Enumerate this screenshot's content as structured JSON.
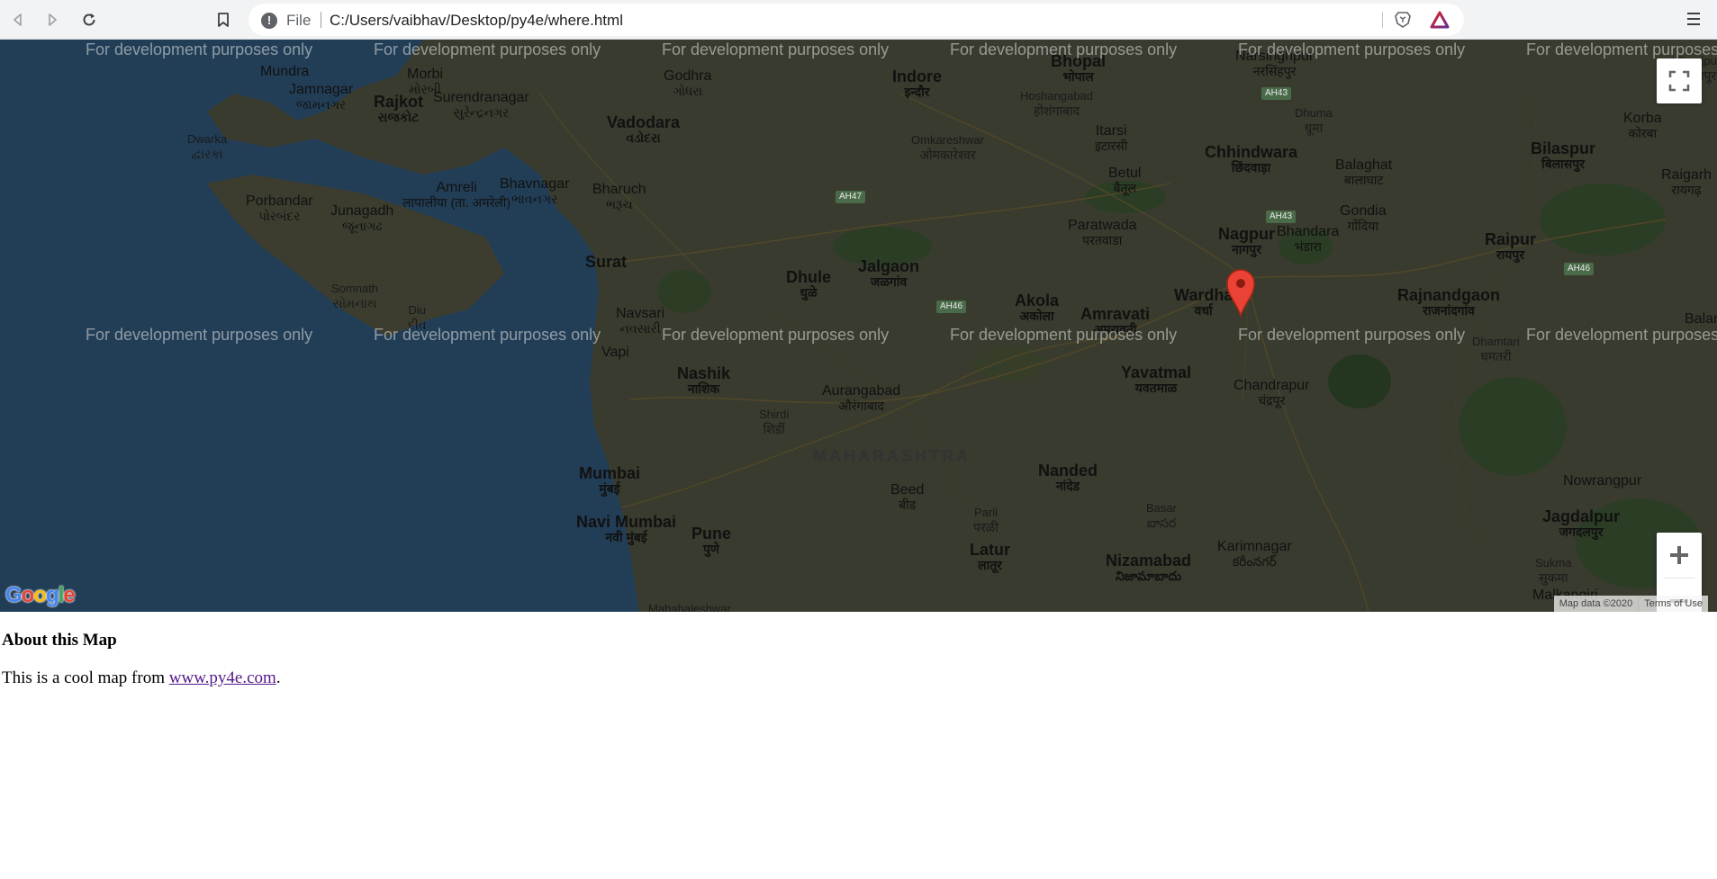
{
  "browser": {
    "scheme_label": "File",
    "url": "C:/Users/vaibhav/Desktop/py4e/where.html"
  },
  "map": {
    "watermark": "For development purposes only",
    "state_label": "MAHARASHTRA",
    "cities": [
      {
        "name": "Mundra",
        "native": ""
      },
      {
        "name": "Jamnagar",
        "native": "જામનગર"
      },
      {
        "name": "Morbi",
        "native": "મોરબી"
      },
      {
        "name": "Rajkot",
        "native": "રાજકોટ"
      },
      {
        "name": "Surendranagar",
        "native": "સુરેન્દ્રનગર"
      },
      {
        "name": "Dwarka",
        "native": "દ્વારકા"
      },
      {
        "name": "Porbandar",
        "native": "પોરબંદર"
      },
      {
        "name": "Junagadh",
        "native": "જૂનાગઢ"
      },
      {
        "name": "Amreli",
        "native": "लापालीया (ता. अमरेली)"
      },
      {
        "name": "Bhavnagar",
        "native": "ભાવનગર"
      },
      {
        "name": "Somnath",
        "native": "સોમનાથ"
      },
      {
        "name": "Diu",
        "native": "દીવ"
      },
      {
        "name": "Godhra",
        "native": "ગોધરા"
      },
      {
        "name": "Vadodara",
        "native": "વડોદરા"
      },
      {
        "name": "Bharuch",
        "native": "ભરૂચ"
      },
      {
        "name": "Surat",
        "native": ""
      },
      {
        "name": "Navsari",
        "native": "નવસારી"
      },
      {
        "name": "Vapi",
        "native": ""
      },
      {
        "name": "Indore",
        "native": "इन्दौर"
      },
      {
        "name": "Bhopal",
        "native": "भोपाल"
      },
      {
        "name": "Hoshangabad",
        "native": "होशंगाबाद"
      },
      {
        "name": "Omkareshwar",
        "native": "ओमकारेश्वर"
      },
      {
        "name": "Itarsi",
        "native": "इटारसी"
      },
      {
        "name": "Betul",
        "native": "बैतूल"
      },
      {
        "name": "Narsinghpur",
        "native": "नरसिंहपुर"
      },
      {
        "name": "Chhindwara",
        "native": "छिंदवाड़ा"
      },
      {
        "name": "Dhuma",
        "native": "धूमा"
      },
      {
        "name": "Balaghat",
        "native": "बालाघाट"
      },
      {
        "name": "Gondia",
        "native": "गोंदिया"
      },
      {
        "name": "Bhandara",
        "native": "भंडारा"
      },
      {
        "name": "Nagpur",
        "native": "नागपुर"
      },
      {
        "name": "Paratwada",
        "native": "परतवाडा"
      },
      {
        "name": "Jalgaon",
        "native": "जळगांव"
      },
      {
        "name": "Dhule",
        "native": "धुळे"
      },
      {
        "name": "Akola",
        "native": "अकोला"
      },
      {
        "name": "Amravati",
        "native": "अमरावती"
      },
      {
        "name": "Wardha",
        "native": "वर्धा"
      },
      {
        "name": "Yavatmal",
        "native": "यवतमाळ"
      },
      {
        "name": "Chandrapur",
        "native": "चंद्रपूर"
      },
      {
        "name": "Nashik",
        "native": "नाशिक"
      },
      {
        "name": "Shirdi",
        "native": "शिर्डी"
      },
      {
        "name": "Aurangabad",
        "native": "औरंगाबाद"
      },
      {
        "name": "Mumbai",
        "native": "मुंबई"
      },
      {
        "name": "Navi Mumbai",
        "native": "नवी मुंबई"
      },
      {
        "name": "Pune",
        "native": "पुणे"
      },
      {
        "name": "Mahabaleshwar",
        "native": ""
      },
      {
        "name": "Beed",
        "native": "बीड"
      },
      {
        "name": "Parli",
        "native": "परळी"
      },
      {
        "name": "Nanded",
        "native": "नांदेड"
      },
      {
        "name": "Latur",
        "native": "लातूर"
      },
      {
        "name": "Basar",
        "native": "బాసర"
      },
      {
        "name": "Nizamabad",
        "native": "నిజామాబాదు"
      },
      {
        "name": "Karimnagar",
        "native": "కరీంనగర్"
      },
      {
        "name": "Surajpur",
        "native": "सूरजपुर"
      },
      {
        "name": "Korba",
        "native": "कोरबा"
      },
      {
        "name": "Bilaspur",
        "native": "बिलासपुर"
      },
      {
        "name": "Raigarh",
        "native": "रायगढ़"
      },
      {
        "name": "Raipur",
        "native": "रायपुर"
      },
      {
        "name": "Rajnandgaon",
        "native": "राजनांदगांव"
      },
      {
        "name": "Dhamtari",
        "native": "धमतरी"
      },
      {
        "name": "Balang",
        "native": ""
      },
      {
        "name": "Nowrangpur",
        "native": ""
      },
      {
        "name": "Jagdalpur",
        "native": "जगदलपुर"
      },
      {
        "name": "Sukma",
        "native": "सुकमा"
      },
      {
        "name": "Malkangiri",
        "native": ""
      }
    ],
    "highways": [
      "AH47",
      "AH46",
      "AH43",
      "AH43",
      "AH46"
    ],
    "attribution": "Map data ©2020",
    "terms": "Terms of Use",
    "logo_letters": [
      "G",
      "o",
      "o",
      "g",
      "l",
      "e"
    ],
    "colors": {
      "sea": "#365b7c",
      "land": "#585a4a",
      "forest": "#3f5d38",
      "marker": "#ea4335"
    }
  },
  "content": {
    "heading": "About this Map",
    "text_before": "This is a cool map from ",
    "link_text": "www.py4e.com",
    "text_after": "."
  }
}
